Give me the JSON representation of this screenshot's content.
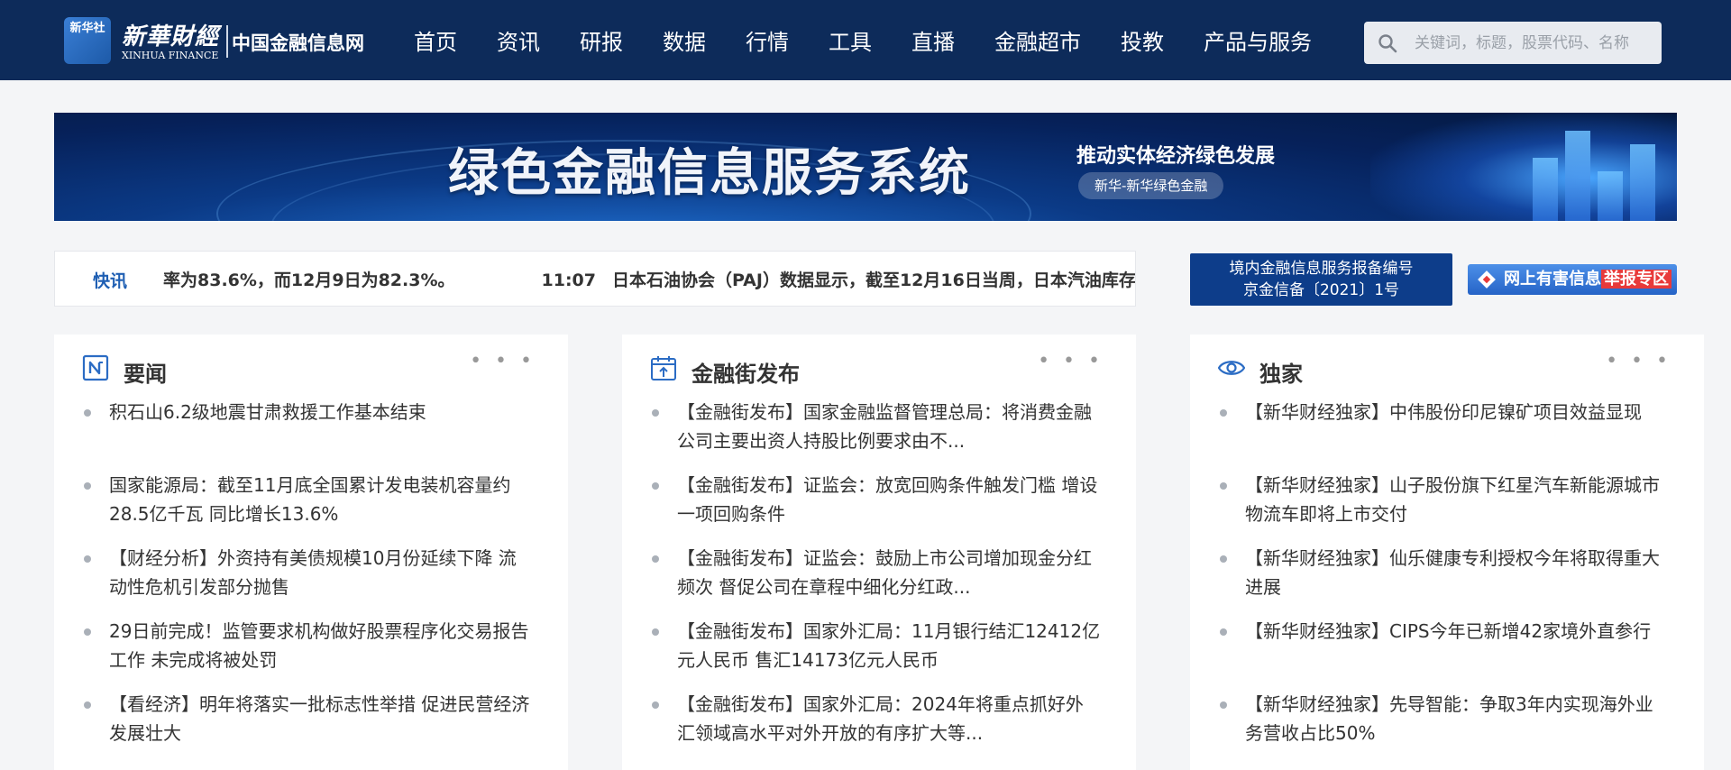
{
  "header": {
    "logo": {
      "badge": "新华社",
      "name_cn": "新華財經",
      "name_en": "XINHUA FINANCE",
      "site": "中国金融信息网"
    },
    "nav": [
      "首页",
      "资讯",
      "研报",
      "数据",
      "行情",
      "工具",
      "直播",
      "金融超市",
      "投教",
      "产品与服务"
    ],
    "search": {
      "placeholder": "关键词，标题，股票代码、名称",
      "icon": "search-icon"
    }
  },
  "banner": {
    "title": "绿色金融信息服务系统",
    "subtitle": "推动实体经济绿色发展",
    "tag": "新华-新华绿色金融"
  },
  "ticker": {
    "label": "快讯",
    "text_prev": "率为83.6%，而12月9日为82.3%。",
    "time": "11:07",
    "text": "日本石油协会（PAJ）数据显示，截至12月16日当周，日本汽油库存"
  },
  "notice": {
    "line1": "境内金融信息服务报备编号",
    "line2": "京金信备〔2021〕1号"
  },
  "report": {
    "text": "网上有害信息",
    "highlight": "举报专区"
  },
  "columns": [
    {
      "title": "要闻",
      "icon": "news-icon",
      "items": [
        "积石山6.2级地震甘肃救援工作基本结束",
        "国家能源局：截至11月底全国累计发电装机容量约28.5亿千瓦 同比增长13.6%",
        "【财经分析】外资持有美债规模10月份延续下降 流动性危机引发部分抛售",
        "29日前完成！监管要求机构做好股票程序化交易报告工作 未完成将被处罚",
        "【看经济】明年将落实一批标志性举措 促进民营经济发展壮大"
      ]
    },
    {
      "title": "金融街发布",
      "icon": "calendar-icon",
      "items": [
        "【金融街发布】国家金融监督管理总局：将消费金融公司主要出资人持股比例要求由不...",
        "【金融街发布】证监会：放宽回购条件触发门槛 增设一项回购条件",
        "【金融街发布】证监会：鼓励上市公司增加现金分红频次 督促公司在章程中细化分红政...",
        "【金融街发布】国家外汇局：11月银行结汇12412亿元人民币 售汇14173亿元人民币",
        "【金融街发布】国家外汇局：2024年将重点抓好外汇领域高水平对外开放的有序扩大等..."
      ]
    },
    {
      "title": "独家",
      "icon": "eye-icon",
      "items": [
        "【新华财经独家】中伟股份印尼镍矿项目效益显现",
        "【新华财经独家】山子股份旗下红星汽车新能源城市物流车即将上市交付",
        "【新华财经独家】仙乐健康专利授权今年将取得重大进展",
        "【新华财经独家】CIPS今年已新增42家境外直参行",
        "【新华财经独家】先导智能：争取3年内实现海外业务营收占比50%"
      ]
    }
  ],
  "more_label": "• • •"
}
